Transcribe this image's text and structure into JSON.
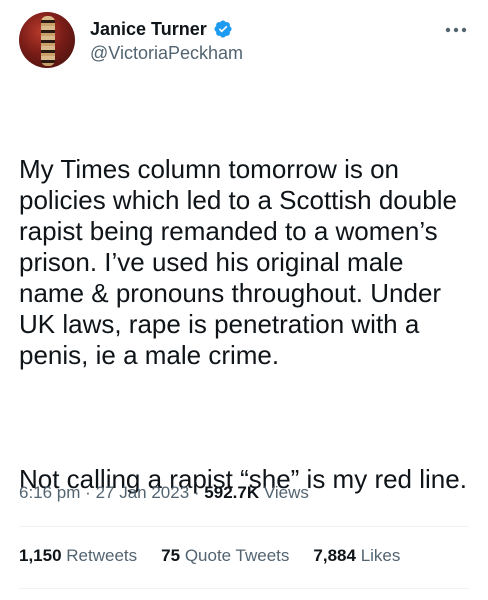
{
  "user": {
    "display_name": "Janice Turner",
    "handle": "@VictoriaPeckham",
    "verified": true
  },
  "tweet": {
    "paragraph_1": "My Times column tomorrow is on policies which led to a Scottish double rapist being remanded to a women’s prison. I’ve used his original male name & pronouns throughout. Under UK laws, rape is penetration with a penis, ie a male crime.",
    "paragraph_2": "Not calling a rapist “she” is my red line."
  },
  "meta": {
    "time": "6:16 pm",
    "date": "27 Jan 2023",
    "views_count": "592.7K",
    "views_label": "Views"
  },
  "stats": {
    "retweets_count": "1,150",
    "retweets_label": "Retweets",
    "quote_tweets_count": "75",
    "quote_tweets_label": "Quote Tweets",
    "likes_count": "7,884",
    "likes_label": "Likes"
  },
  "colors": {
    "verified_blue": "#1d9bf0",
    "text_primary": "#0f1419",
    "text_secondary": "#536471",
    "divider": "#eff3f4"
  },
  "icons": {
    "verified": "verified-badge-icon",
    "more": "more-horizontal-icon"
  }
}
